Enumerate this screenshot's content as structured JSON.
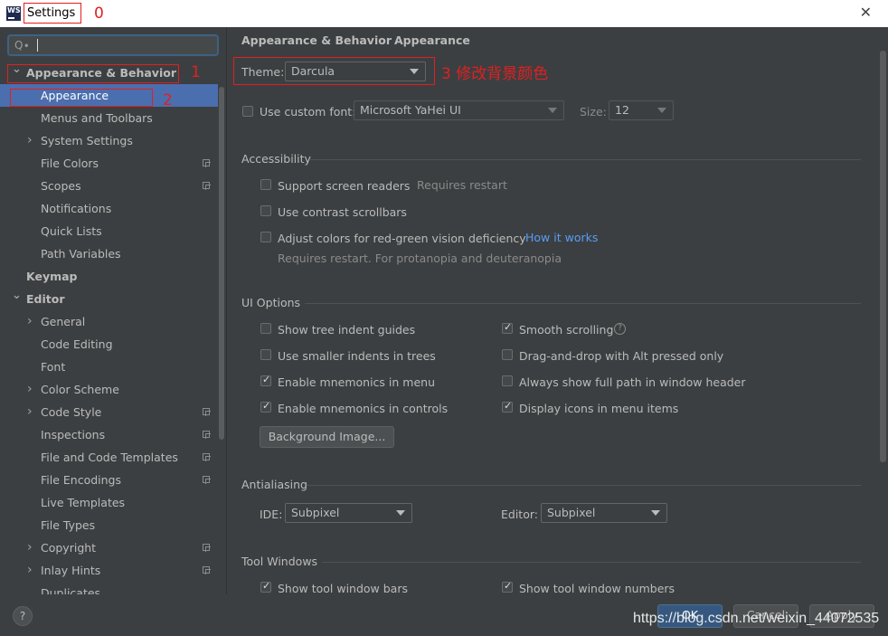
{
  "window": {
    "title": "Settings",
    "close_glyph": "✕",
    "logo_text": "WS"
  },
  "annotations": {
    "a0": "0",
    "a1": "1",
    "a2": "2",
    "a3": "3 修改背景颜色"
  },
  "sidebar": {
    "search_icon": "Q∙",
    "items": [
      {
        "label": "Appearance & Behavior",
        "level": 0,
        "expanded": true
      },
      {
        "label": "Appearance",
        "level": 1,
        "selected": true
      },
      {
        "label": "Menus and Toolbars",
        "level": 1
      },
      {
        "label": "System Settings",
        "level": 1,
        "collapsed": true
      },
      {
        "label": "File Colors",
        "level": 1,
        "project_icon": true
      },
      {
        "label": "Scopes",
        "level": 1,
        "project_icon": true
      },
      {
        "label": "Notifications",
        "level": 1
      },
      {
        "label": "Quick Lists",
        "level": 1
      },
      {
        "label": "Path Variables",
        "level": 1
      },
      {
        "label": "Keymap",
        "level": 0
      },
      {
        "label": "Editor",
        "level": 0,
        "expanded": true
      },
      {
        "label": "General",
        "level": 1,
        "collapsed": true
      },
      {
        "label": "Code Editing",
        "level": 1
      },
      {
        "label": "Font",
        "level": 1
      },
      {
        "label": "Color Scheme",
        "level": 1,
        "collapsed": true
      },
      {
        "label": "Code Style",
        "level": 1,
        "collapsed": true,
        "project_icon": true
      },
      {
        "label": "Inspections",
        "level": 1,
        "project_icon": true
      },
      {
        "label": "File and Code Templates",
        "level": 1,
        "project_icon": true
      },
      {
        "label": "File Encodings",
        "level": 1,
        "project_icon": true
      },
      {
        "label": "Live Templates",
        "level": 1
      },
      {
        "label": "File Types",
        "level": 1
      },
      {
        "label": "Copyright",
        "level": 1,
        "collapsed": true,
        "project_icon": true
      },
      {
        "label": "Inlay Hints",
        "level": 1,
        "collapsed": true,
        "project_icon": true
      },
      {
        "label": "Duplicates",
        "level": 1
      }
    ]
  },
  "breadcrumb": {
    "parent": "Appearance & Behavior",
    "separator": "›",
    "current": "Appearance"
  },
  "theme": {
    "label": "Theme:",
    "value": "Darcula"
  },
  "font": {
    "checkbox_label": "Use custom font:",
    "value": "Microsoft YaHei UI",
    "size_label": "Size:",
    "size_value": "12"
  },
  "accessibility": {
    "header": "Accessibility",
    "screen_readers": "Support screen readers",
    "requires_restart": "Requires restart",
    "contrast_scrollbars": "Use contrast scrollbars",
    "color_deficiency": "Adjust colors for red-green vision deficiency",
    "how_it_works": "How it works",
    "deficiency_note": "Requires restart. For protanopia and deuteranopia"
  },
  "ui_options": {
    "header": "UI Options",
    "left": [
      {
        "label": "Show tree indent guides",
        "checked": false
      },
      {
        "label": "Use smaller indents in trees",
        "checked": false
      },
      {
        "label": "Enable mnemonics in menu",
        "checked": true
      },
      {
        "label": "Enable mnemonics in controls",
        "checked": true
      }
    ],
    "right": [
      {
        "label": "Smooth scrolling",
        "checked": true
      },
      {
        "label": "Drag-and-drop with Alt pressed only",
        "checked": false
      },
      {
        "label": "Always show full path in window header",
        "checked": false
      },
      {
        "label": "Display icons in menu items",
        "checked": true
      }
    ],
    "help_glyph": "?",
    "background_button": "Background Image..."
  },
  "antialiasing": {
    "header": "Antialiasing",
    "ide_label": "IDE:",
    "ide_value": "Subpixel",
    "editor_label": "Editor:",
    "editor_value": "Subpixel"
  },
  "tool_windows": {
    "header": "Tool Windows",
    "show_bars": "Show tool window bars",
    "show_numbers": "Show tool window numbers"
  },
  "footer": {
    "help": "?",
    "ok": "OK",
    "cancel": "Cancel",
    "apply": "Apply"
  },
  "watermark": "https://blog.csdn.net/weixin_44072535",
  "colors": {
    "accent": "#4b6eaf",
    "link": "#589df6",
    "annotation": "#e02020",
    "ok_button": "#365880"
  }
}
